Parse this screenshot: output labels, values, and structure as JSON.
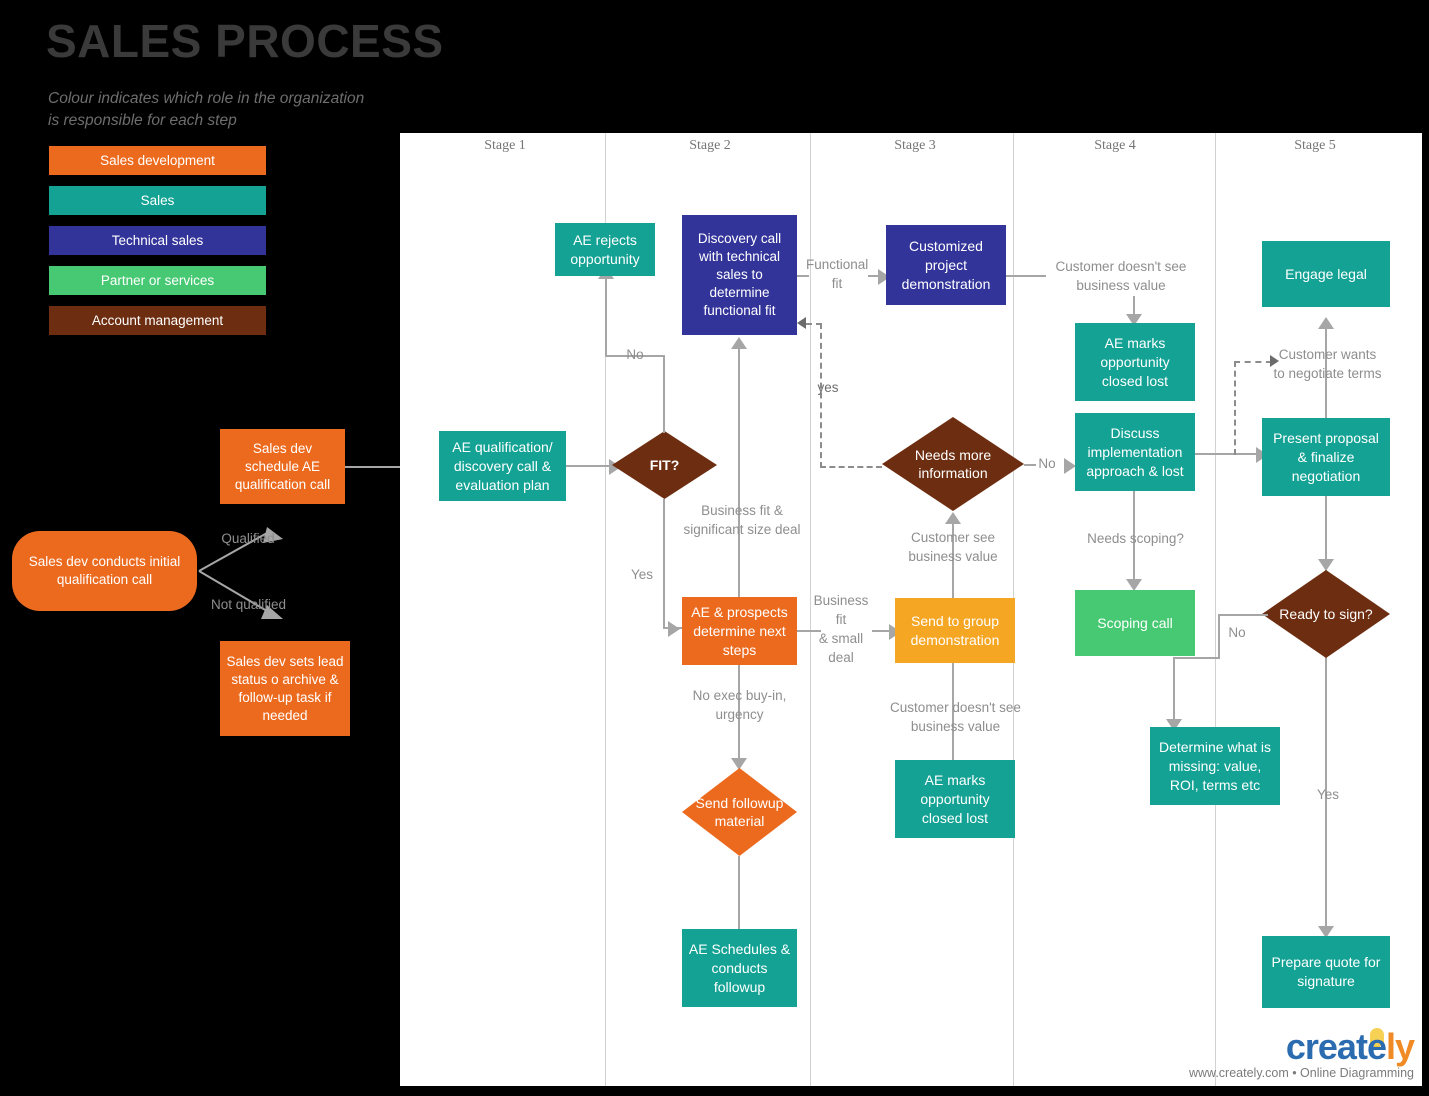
{
  "header": {
    "title": "SALES PROCESS",
    "subtitle": "Colour indicates which role in the organization  is responsible for each step"
  },
  "legend": {
    "items": [
      {
        "label": "Sales development",
        "color": "#ec6a1e"
      },
      {
        "label": "Sales",
        "color": "#13a294"
      },
      {
        "label": "Technical sales",
        "color": "#33349a"
      },
      {
        "label": "Partner or services",
        "color": "#47c973"
      },
      {
        "label": "Account management",
        "color": "#6d2d10"
      }
    ]
  },
  "stages": [
    {
      "label": "Stage 1"
    },
    {
      "label": "Stage 2"
    },
    {
      "label": "Stage 3"
    },
    {
      "label": "Stage 4"
    },
    {
      "label": "Stage 5"
    }
  ],
  "nodes": {
    "initial_qualification": "Sales dev conducts initial qualification call",
    "schedule_ae_call": "Sales dev schedule AE qualification call",
    "lead_status": "Sales dev sets lead status o archive & follow-up task if needed",
    "ae_qualification": "AE qualification/ discovery call & evaluation plan",
    "fit_decision": "FIT?",
    "ae_rejects": "AE rejects opportunity",
    "discovery_call": "Discovery call with technical sales to determine functional fit",
    "ae_prospects_next_steps": "AE & prospects determine next steps",
    "send_followup": "Send followup  material",
    "ae_schedules_followup": "AE Schedules & conducts followup",
    "customized_demo": "Customized project demonstration",
    "needs_more_info": "Needs more information",
    "send_group_demo": "Send to group demonstration",
    "ae_marks_lost_s3": "AE marks opportunity closed lost",
    "ae_marks_lost_s4": "AE marks opportunity closed lost",
    "discuss_implementation": "Discuss implementation approach & lost",
    "scoping_call": "Scoping call",
    "engage_legal": "Engage legal",
    "present_proposal": "Present proposal & finalize negotiation",
    "ready_to_sign": "Ready to sign?",
    "determine_missing": "Determine what is missing: value, ROI, terms etc",
    "prepare_quote": "Prepare quote for signature"
  },
  "edge_labels": {
    "qualified": "Qualified",
    "not_qualified": "Not qualified",
    "fit_no": "No",
    "fit_yes": "Yes",
    "business_fit_significant": "Business fit &\nsignificant size deal",
    "no_exec_buyin": "No exec buy-in,\nurgency",
    "functional_fit": "Functional\nfit",
    "yes_more_info": "yes",
    "business_fit_small": "Business\nfit\n& small\ndeal",
    "customer_see_value": "Customer see\nbusiness value",
    "customer_no_value_s3": "Customer doesn't see\nbusiness value",
    "customer_no_value_s4": "Customer doesn't see\nbusiness value",
    "needs_more_info_no": "No",
    "needs_scoping": "Needs scoping?",
    "customer_wants_negotiate": "Customer wants\nto negotiate terms",
    "ready_no": "No",
    "ready_yes": "Yes"
  },
  "brand": {
    "name_part1": "create",
    "name_part2": "ly",
    "tagline": "www.creately.com • Online Diagramming"
  },
  "colors": {
    "sales_development": "#ec6a1e",
    "sales": "#13a294",
    "technical_sales": "#33349a",
    "partner_services": "#47c973",
    "account_management": "#6d2d10",
    "highlight_orange": "#f5a623",
    "connector": "#a6a6a6",
    "canvas": "#ffffff",
    "background": "#000000"
  }
}
